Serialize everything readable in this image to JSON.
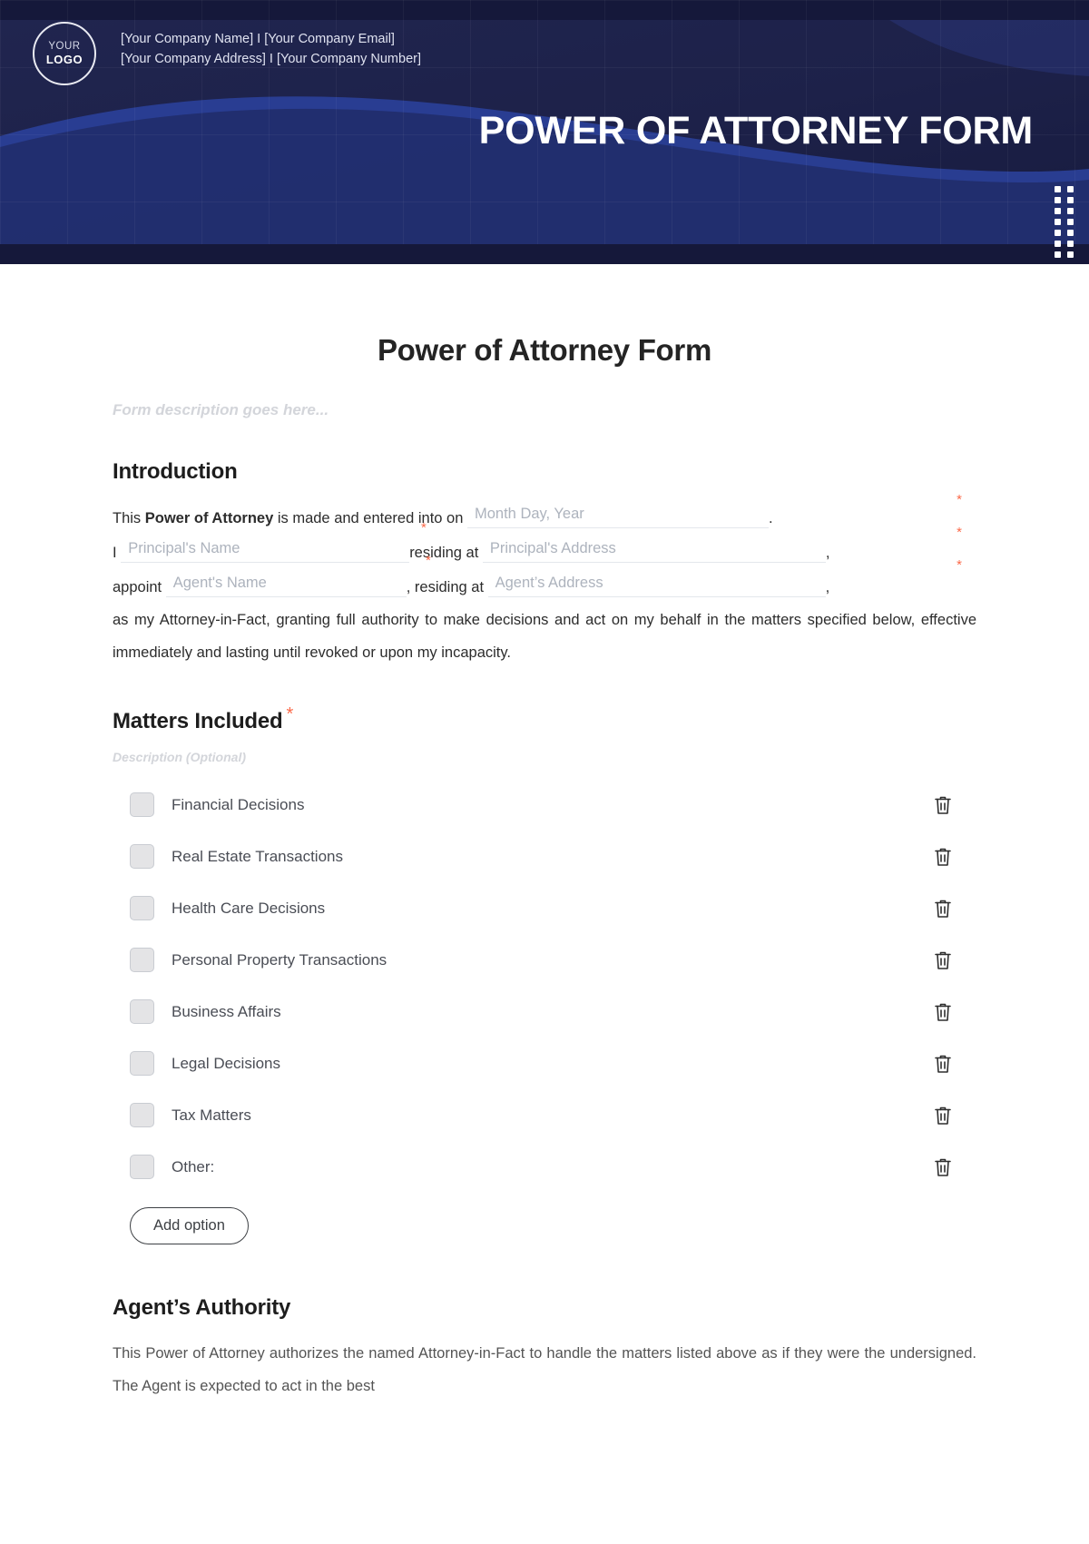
{
  "banner": {
    "logo": {
      "line1": "YOUR",
      "line2": "LOGO"
    },
    "company_line1": "[Your Company Name] I [Your Company Email]",
    "company_line2": "[Your Company Address] I [Your Company Number]",
    "title": "POWER OF ATTORNEY FORM",
    "colors": {
      "dark": "#1b1f47",
      "darker": "#15183a",
      "wave": "#223a90"
    }
  },
  "document": {
    "title": "Power of Attorney Form",
    "description": "Form description goes here..."
  },
  "introduction": {
    "heading": "Introduction",
    "text_1": "This ",
    "text_bold": "Power of Attorney",
    "text_2": " is made and entered into on",
    "date_placeholder": "Month Day, Year",
    "period": ".",
    "i_word": "I",
    "principal_name_placeholder": "Principal's Name",
    "residing_at_1": "residing at",
    "principal_address_placeholder": "Principal's Address",
    "comma_1": ",",
    "appoint_word": "appoint",
    "agent_name_placeholder": "Agent's Name",
    "residing_at_2": ", residing at",
    "agent_address_placeholder": "Agent’s Address",
    "comma_2": ",",
    "closing_text": "as my Attorney-in-Fact, granting full authority to make decisions and act on my behalf in the matters specified below, effective immediately and lasting until revoked or upon my incapacity.",
    "required_marker": "*"
  },
  "matters": {
    "heading": "Matters Included",
    "required_marker": "*",
    "description_placeholder": "Description (Optional)",
    "options": [
      {
        "label": "Financial Decisions",
        "checked": false
      },
      {
        "label": "Real Estate Transactions",
        "checked": false
      },
      {
        "label": "Health Care Decisions",
        "checked": false
      },
      {
        "label": "Personal Property Transactions",
        "checked": false
      },
      {
        "label": "Business Affairs",
        "checked": false
      },
      {
        "label": "Legal Decisions",
        "checked": false
      },
      {
        "label": "Tax Matters",
        "checked": false
      },
      {
        "label": "Other:",
        "checked": false
      }
    ],
    "add_option_label": "Add option",
    "delete_icon": "trash-icon"
  },
  "agent_authority": {
    "heading": "Agent’s Authority",
    "paragraph": "This Power of Attorney authorizes the named Attorney-in-Fact to handle the matters listed above as if they were the undersigned. The Agent is expected to act in the best"
  },
  "accent_colors": {
    "required_star": "#fb6a4a",
    "placeholder_text": "#adb3bd",
    "field_underline": "#e4e7ec"
  }
}
